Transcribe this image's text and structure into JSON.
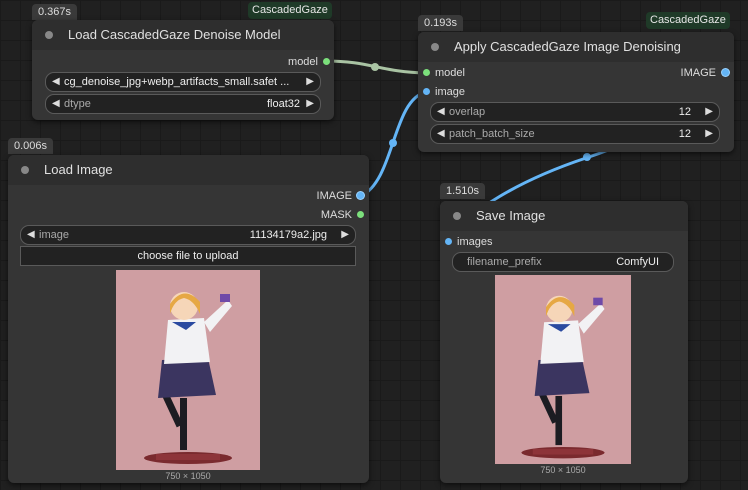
{
  "nodes": {
    "load_model": {
      "timer": "0.367s",
      "badge": "CascadedGaze",
      "title": "Load CascadedGaze Denoise Model",
      "outputs": [
        "model"
      ],
      "widgets": [
        {
          "label": "",
          "value": "cg_denoise_jpg+webp_artifacts_small.safet ..."
        },
        {
          "label": "dtype",
          "value": "float32"
        }
      ]
    },
    "apply": {
      "timer": "0.193s",
      "badge": "CascadedGaze",
      "title": "Apply CascadedGaze Image Denoising",
      "inputs": [
        "model",
        "image"
      ],
      "outputs": [
        "IMAGE"
      ],
      "widgets": [
        {
          "label": "overlap",
          "value": "12"
        },
        {
          "label": "patch_batch_size",
          "value": "12"
        }
      ]
    },
    "load_image": {
      "timer": "0.006s",
      "title": "Load Image",
      "outputs": [
        "IMAGE",
        "MASK"
      ],
      "widgets": [
        {
          "label": "image",
          "value": "11134179a2.jpg"
        }
      ],
      "upload_label": "choose file to upload",
      "dims": "750 × 1050"
    },
    "save_image": {
      "timer": "1.510s",
      "title": "Save Image",
      "inputs": [
        "images"
      ],
      "widgets": [
        {
          "label": "filename_prefix",
          "value": "ComfyUI"
        }
      ],
      "dims": "750 × 1050"
    }
  },
  "colors": {
    "model_wire": "#a9c3a3",
    "image_wire": "#64b5f6",
    "canvas": "#202020",
    "node": "#353535"
  }
}
